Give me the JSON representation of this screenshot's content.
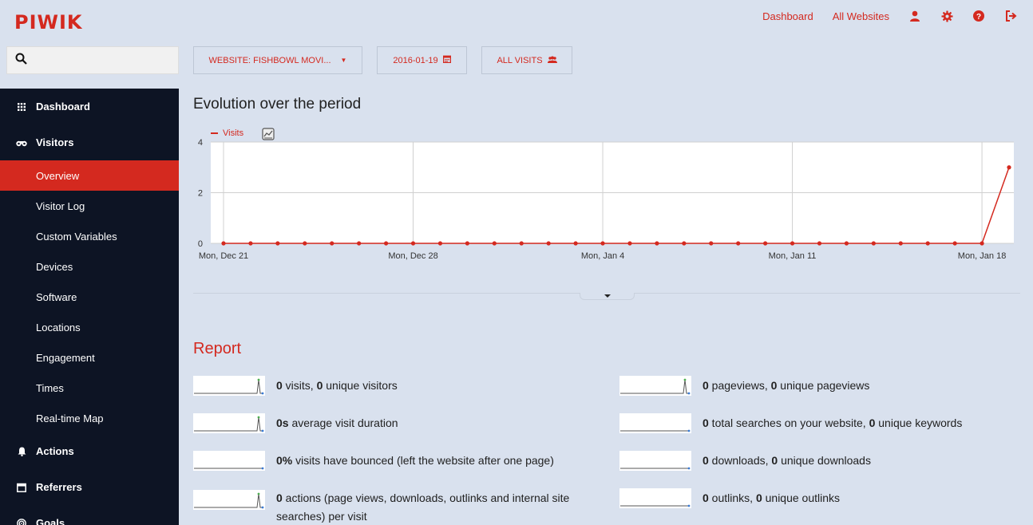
{
  "brand": "PIWIK",
  "topnav": {
    "dashboard": "Dashboard",
    "all_websites": "All Websites"
  },
  "icons": [
    "search-icon",
    "user-icon",
    "gear-icon",
    "help-icon",
    "logout-icon",
    "dashboard-icon",
    "binoculars-icon",
    "bell-icon",
    "calendar-icon",
    "target-icon",
    "chart-icon",
    "segment-icon"
  ],
  "colors": {
    "accent": "#d4291f",
    "sidebar": "#0d1424",
    "background": "#d9e1ee"
  },
  "search": {
    "value": ""
  },
  "sidebar": {
    "dashboard": "Dashboard",
    "visitors": "Visitors",
    "visitor_items": [
      "Overview",
      "Visitor Log",
      "Custom Variables",
      "Devices",
      "Software",
      "Locations",
      "Engagement",
      "Times",
      "Real-time Map"
    ],
    "active_item": "Overview",
    "actions": "Actions",
    "referrers": "Referrers",
    "goals": "Goals"
  },
  "selectors": {
    "website": "WEBSITE: FISHBOWL MOVI...",
    "date": "2016-01-19",
    "segment": "ALL VISITS"
  },
  "evolution": {
    "title": "Evolution over the period",
    "legend": "Visits"
  },
  "chart_data": {
    "type": "line",
    "series": [
      {
        "name": "Visits",
        "values": [
          0,
          0,
          0,
          0,
          0,
          0,
          0,
          0,
          0,
          0,
          0,
          0,
          0,
          0,
          0,
          0,
          0,
          0,
          0,
          0,
          0,
          0,
          0,
          0,
          0,
          0,
          0,
          0,
          0,
          3
        ]
      }
    ],
    "x": [
      "2015-12-21",
      "2015-12-22",
      "2015-12-23",
      "2015-12-24",
      "2015-12-25",
      "2015-12-26",
      "2015-12-27",
      "2015-12-28",
      "2015-12-29",
      "2015-12-30",
      "2015-12-31",
      "2016-01-01",
      "2016-01-02",
      "2016-01-03",
      "2016-01-04",
      "2016-01-05",
      "2016-01-06",
      "2016-01-07",
      "2016-01-08",
      "2016-01-09",
      "2016-01-10",
      "2016-01-11",
      "2016-01-12",
      "2016-01-13",
      "2016-01-14",
      "2016-01-15",
      "2016-01-16",
      "2016-01-17",
      "2016-01-18",
      "2016-01-19"
    ],
    "xtick_labels": [
      "Mon, Dec 21",
      "Mon, Dec 28",
      "Mon, Jan 4",
      "Mon, Jan 11",
      "Mon, Jan 18"
    ],
    "y_ticks": [
      "0",
      "2",
      "4"
    ],
    "ylim": [
      0,
      4
    ],
    "grid": true,
    "legend_position": "top-left"
  },
  "report": {
    "title": "Report",
    "metrics": [
      {
        "v1": "0",
        "t1": " visits, ",
        "v2": "0",
        "t2": " unique visitors"
      },
      {
        "v1": "0",
        "t1": " pageviews, ",
        "v2": "0",
        "t2": " unique pageviews"
      },
      {
        "v1": "0s",
        "t1": " average visit duration"
      },
      {
        "v1": "0",
        "t1": " total searches on your website, ",
        "v2": "0",
        "t2": " unique keywords"
      },
      {
        "v1": "0%",
        "t1": " visits have bounced (left the website after one page)"
      },
      {
        "v1": "0",
        "t1": " downloads, ",
        "v2": "0",
        "t2": " unique downloads"
      },
      {
        "v1": "0",
        "t1": " actions (page views, downloads, outlinks and internal site searches) per visit"
      },
      {
        "v1": "0",
        "t1": " outlinks, ",
        "v2": "0",
        "t2": " unique outlinks"
      }
    ]
  }
}
